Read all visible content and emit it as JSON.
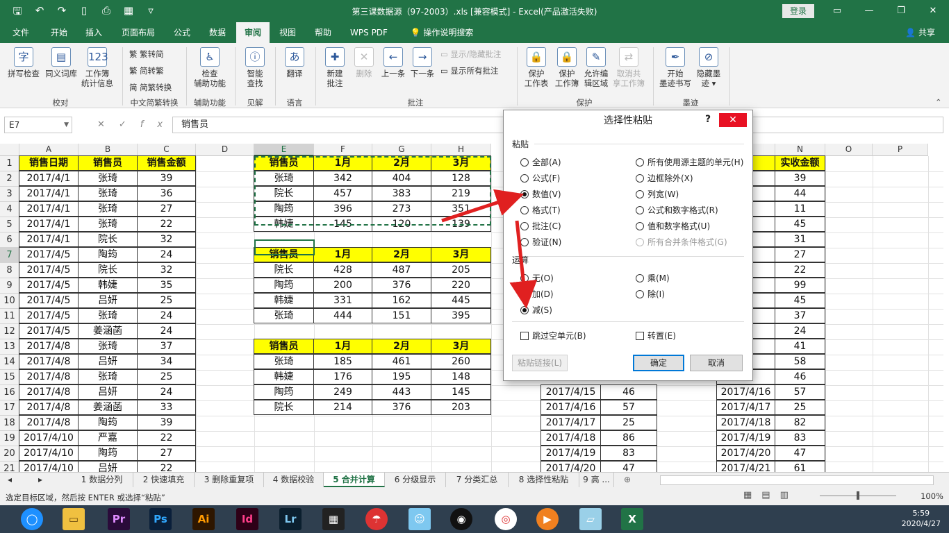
{
  "window": {
    "title": "第三课数据源（97-2003）.xls  [兼容模式]  -  Excel(产品激活失败)",
    "login": "登录"
  },
  "ribbon_tabs": [
    "文件",
    "开始",
    "插入",
    "页面布局",
    "公式",
    "数据",
    "审阅",
    "视图",
    "帮助",
    "WPS PDF",
    "操作说明搜索"
  ],
  "active_tab": "审阅",
  "share": "共享",
  "ribbon": {
    "spell": "拼写检查",
    "thesaurus": "同义词库",
    "workbook_stats_1": "工作簿",
    "workbook_stats_2": "统计信息",
    "group_proofing": "校对",
    "trad_to_simp": "繁转简",
    "simp_to_trad": "简转繁",
    "convert": "简繁转换",
    "group_chinese": "中文简繁转换",
    "check_1": "检查",
    "check_2": "辅助功能",
    "group_access": "辅助功能",
    "smart_1": "智能",
    "smart_2": "查找",
    "group_insights": "见解",
    "translate": "翻译",
    "group_language": "语言",
    "new_comment_1": "新建",
    "new_comment_2": "批注",
    "delete": "删除",
    "prev": "上一条",
    "next": "下一条",
    "show_hide": "显示/隐藏批注",
    "show_all": "显示所有批注",
    "group_comments": "批注",
    "protect_sheet_1": "保护",
    "protect_sheet_2": "工作表",
    "protect_wb_1": "保护",
    "protect_wb_2": "工作簿",
    "allow_edit_1": "允许编",
    "allow_edit_2": "辑区域",
    "unshare_1": "取消共",
    "unshare_2": "享工作簿",
    "group_protect": "保护",
    "ink_1": "开始",
    "ink_2": "墨迹书写",
    "hide_ink_1": "隐藏墨",
    "hide_ink_2": "迹 ▾",
    "group_ink": "墨迹"
  },
  "formula_bar": {
    "name_box": "E7",
    "formula": "销售员"
  },
  "columns": [
    "A",
    "B",
    "C",
    "D",
    "E",
    "F",
    "G",
    "H",
    "M",
    "N",
    "O",
    "P"
  ],
  "rows": [
    "1",
    "2",
    "3",
    "4",
    "5",
    "6",
    "7",
    "8",
    "9",
    "10",
    "11",
    "12",
    "13",
    "14",
    "15",
    "16",
    "17",
    "18",
    "19",
    "20",
    "21"
  ],
  "table_main": {
    "headers": [
      "销售日期",
      "销售员",
      "销售金额"
    ],
    "rows": [
      [
        "2017/4/1",
        "张琦",
        "39"
      ],
      [
        "2017/4/1",
        "张琦",
        "36"
      ],
      [
        "2017/4/1",
        "张琦",
        "27"
      ],
      [
        "2017/4/1",
        "张琦",
        "22"
      ],
      [
        "2017/4/1",
        "院长",
        "32"
      ],
      [
        "2017/4/5",
        "陶筠",
        "24"
      ],
      [
        "2017/4/5",
        "院长",
        "32"
      ],
      [
        "2017/4/5",
        "韩婕",
        "35"
      ],
      [
        "2017/4/5",
        "吕妍",
        "25"
      ],
      [
        "2017/4/5",
        "张琦",
        "24"
      ],
      [
        "2017/4/5",
        "姜涵菡",
        "24"
      ],
      [
        "2017/4/8",
        "张琦",
        "37"
      ],
      [
        "2017/4/8",
        "吕妍",
        "34"
      ],
      [
        "2017/4/8",
        "张琦",
        "25"
      ],
      [
        "2017/4/8",
        "吕妍",
        "24"
      ],
      [
        "2017/4/8",
        "姜涵菡",
        "33"
      ],
      [
        "2017/4/8",
        "陶筠",
        "39"
      ],
      [
        "2017/4/10",
        "严嘉",
        "22"
      ],
      [
        "2017/4/10",
        "陶筠",
        "27"
      ],
      [
        "2017/4/10",
        "吕妍",
        "22"
      ]
    ]
  },
  "table_e1": {
    "headers": [
      "销售员",
      "1月",
      "2月",
      "3月"
    ],
    "rows": [
      [
        "张琦",
        "342",
        "404",
        "128"
      ],
      [
        "院长",
        "457",
        "383",
        "219"
      ],
      [
        "陶筠",
        "396",
        "273",
        "351"
      ],
      [
        "韩婕",
        "145",
        "120",
        "139"
      ]
    ]
  },
  "table_e7": {
    "headers": [
      "销售员",
      "1月",
      "2月",
      "3月"
    ],
    "rows": [
      [
        "院长",
        "428",
        "487",
        "205"
      ],
      [
        "陶筠",
        "200",
        "376",
        "220"
      ],
      [
        "韩婕",
        "331",
        "162",
        "445"
      ],
      [
        "张琦",
        "444",
        "151",
        "395"
      ]
    ]
  },
  "table_e13": {
    "headers": [
      "销售员",
      "1月",
      "2月",
      "3月"
    ],
    "rows": [
      [
        "张琦",
        "185",
        "461",
        "260"
      ],
      [
        "韩婕",
        "176",
        "195",
        "148"
      ],
      [
        "陶筠",
        "249",
        "443",
        "145"
      ],
      [
        "院长",
        "214",
        "376",
        "203"
      ]
    ]
  },
  "table_k": [
    [
      "2017/4/15",
      "46"
    ],
    [
      "2017/4/16",
      "57"
    ],
    [
      "2017/4/17",
      "25"
    ],
    [
      "2017/4/18",
      "86"
    ],
    [
      "2017/4/19",
      "83"
    ],
    [
      "2017/4/20",
      "47"
    ]
  ],
  "table_n": {
    "header_m": "期",
    "header_n": "实收金额",
    "rows": [
      [
        "4/1",
        "39"
      ],
      [
        "4/2",
        "44"
      ],
      [
        "4/3",
        "11"
      ],
      [
        "4/4",
        "45"
      ],
      [
        "4/5",
        "31"
      ],
      [
        "4/6",
        "27"
      ],
      [
        "4/7",
        "22"
      ],
      [
        "4/8",
        "99"
      ],
      [
        "4/9",
        "45"
      ],
      [
        "/10",
        "37"
      ],
      [
        "/12",
        "24"
      ],
      [
        "/13",
        "41"
      ],
      [
        "/14",
        "58"
      ],
      [
        "/15",
        "46"
      ],
      [
        "2017/4/16",
        "57"
      ],
      [
        "2017/4/17",
        "25"
      ],
      [
        "2017/4/18",
        "82"
      ],
      [
        "2017/4/19",
        "83"
      ],
      [
        "2017/4/20",
        "47"
      ],
      [
        "2017/4/21",
        "61"
      ]
    ]
  },
  "dialog": {
    "title": "选择性粘贴",
    "help": "?",
    "paste_label": "粘贴",
    "paste_left": [
      "全部(A)",
      "公式(F)",
      "数值(V)",
      "格式(T)",
      "批注(C)",
      "验证(N)"
    ],
    "paste_right": [
      "所有使用源主题的单元(H)",
      "边框除外(X)",
      "列宽(W)",
      "公式和数字格式(R)",
      "值和数字格式(U)",
      "所有合并条件格式(G)"
    ],
    "paste_selected": "数值(V)",
    "op_label": "运算",
    "op_left": [
      "无(O)",
      "加(D)",
      "减(S)"
    ],
    "op_right": [
      "乘(M)",
      "除(I)"
    ],
    "op_selected": "减(S)",
    "skip_blanks": "跳过空单元(B)",
    "transpose": "转置(E)",
    "paste_link": "粘贴链接(L)",
    "ok": "确定",
    "cancel": "取消"
  },
  "sheet_tabs": [
    "1 数据分列",
    "2 快速填充",
    "3 删除重复项",
    "4 数据校验",
    "5 合并计算",
    "6 分级显示",
    "7 分类汇总",
    "8 选择性粘贴",
    "9 高 ..."
  ],
  "active_sheet": "5 合并计算",
  "status": {
    "message": "选定目标区域，然后按 ENTER 或选择“粘贴”",
    "zoom": "100%"
  },
  "taskbar": {
    "time": "5:59",
    "date": "2020/4/27"
  },
  "colors": {
    "excel_green": "#217346",
    "header_yellow": "#ffff00",
    "arrow_red": "#e02020"
  }
}
